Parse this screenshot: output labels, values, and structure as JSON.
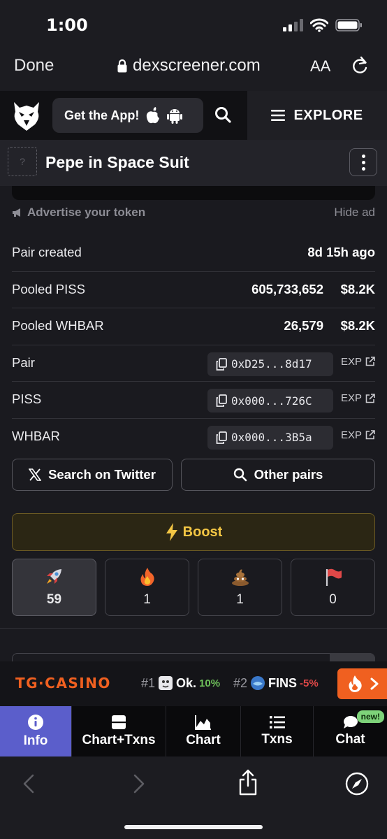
{
  "status": {
    "time": "1:00"
  },
  "browser": {
    "done": "Done",
    "url": "dexscreener.com",
    "text_size": "AA"
  },
  "header": {
    "get_app": "Get the App!",
    "explore": "EXPLORE"
  },
  "token": {
    "icon_placeholder": "?",
    "name": "Pepe in Space Suit"
  },
  "ad": {
    "advertise": "Advertise your token",
    "hide": "Hide ad"
  },
  "info": {
    "pair_created": {
      "label": "Pair created",
      "value": "8d 15h ago"
    },
    "pooled_piss": {
      "label": "Pooled PISS",
      "amount": "605,733,652",
      "usd": "$8.2K"
    },
    "pooled_whbar": {
      "label": "Pooled WHBAR",
      "amount": "26,579",
      "usd": "$8.2K"
    },
    "pair": {
      "label": "Pair",
      "address": "0xD25...8d17",
      "exp": "EXP"
    },
    "piss": {
      "label": "PISS",
      "address": "0x000...726C",
      "exp": "EXP"
    },
    "whbar": {
      "label": "WHBAR",
      "address": "0x000...3B5a",
      "exp": "EXP"
    }
  },
  "actions": {
    "twitter": "Search on Twitter",
    "other_pairs": "Other pairs",
    "boost": "Boost"
  },
  "votes": [
    {
      "icon": "rocket-icon",
      "count": "59"
    },
    {
      "icon": "fire-icon",
      "count": "1"
    },
    {
      "icon": "poop-icon",
      "count": "1"
    },
    {
      "icon": "flag-icon",
      "count": "0"
    }
  ],
  "promo": {
    "logo": "TG·CASINO",
    "trend1": {
      "rank": "#1",
      "name": "Ok.",
      "change": "10%"
    },
    "trend2": {
      "rank": "#2",
      "name": "FINS",
      "change": "-5%"
    }
  },
  "nav": {
    "info": "Info",
    "chart_txns": "Chart+Txns",
    "chart": "Chart",
    "txns": "Txns",
    "chat": "Chat",
    "new_badge": "new!"
  },
  "colors": {
    "accent": "#5b5ecb",
    "boost": "#f3c644",
    "promo": "#f06020"
  }
}
